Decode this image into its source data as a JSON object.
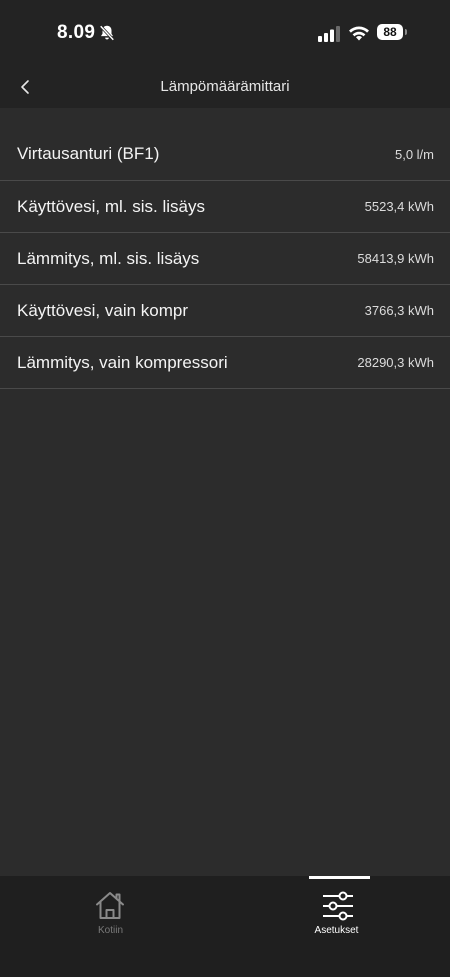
{
  "status_bar": {
    "time": "8.09",
    "battery": "88"
  },
  "header": {
    "title": "Lämpömäärämittari"
  },
  "rows": [
    {
      "label": "Virtausanturi (BF1)",
      "value": "5,0 l/m"
    },
    {
      "label": "Käyttövesi, ml. sis. lisäys",
      "value": "5523,4 kWh"
    },
    {
      "label": "Lämmitys, ml. sis. lisäys",
      "value": "58413,9 kWh"
    },
    {
      "label": "Käyttövesi, vain kompr",
      "value": "3766,3 kWh"
    },
    {
      "label": "Lämmitys, vain kompressori",
      "value": "28290,3 kWh"
    }
  ],
  "tabs": {
    "home": {
      "label": "Kotiin",
      "icon": "home-icon",
      "active": false
    },
    "settings": {
      "label": "Asetukset",
      "icon": "sliders-icon",
      "active": true
    }
  }
}
